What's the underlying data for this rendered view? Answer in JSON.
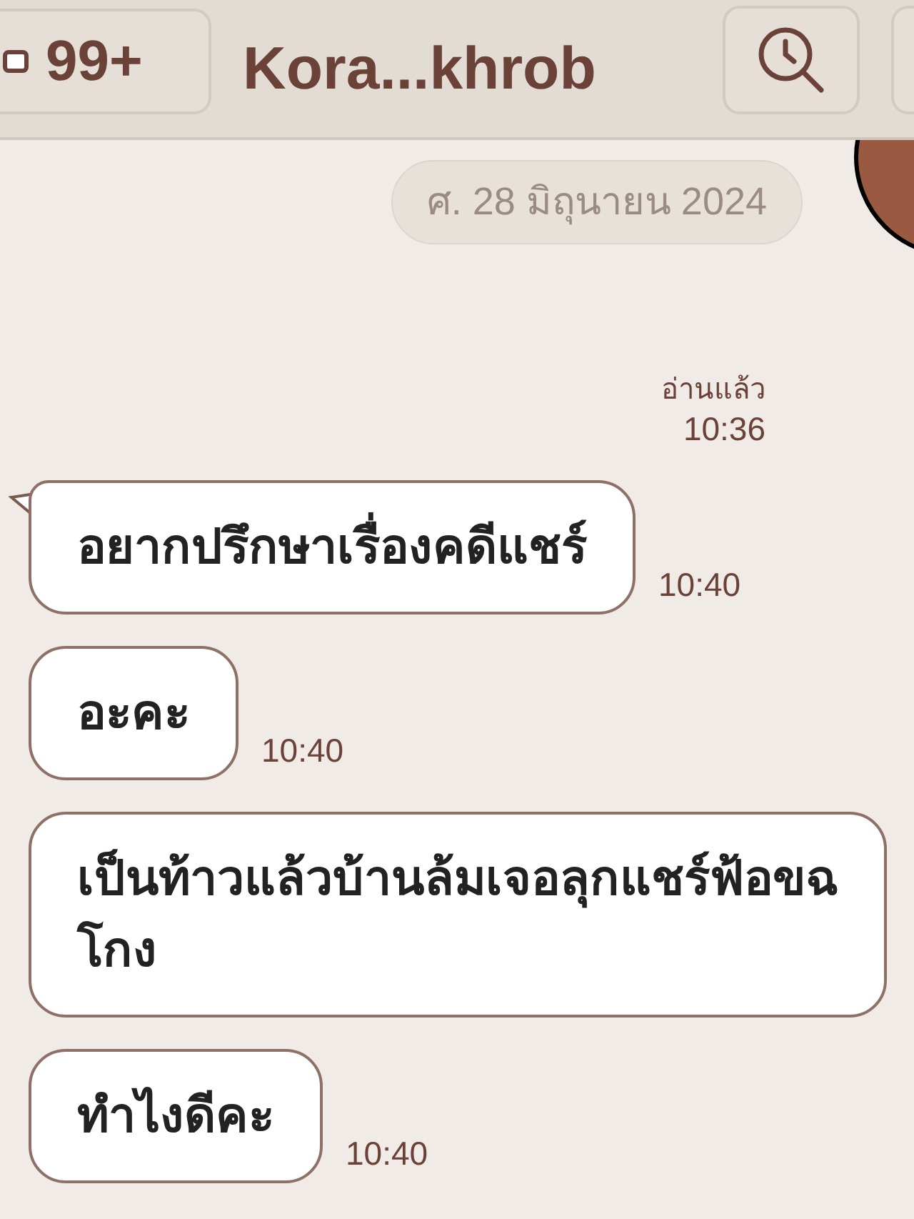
{
  "header": {
    "unread": "99+",
    "title": "Kora...khrob"
  },
  "date": "ศ. 28 มิถุนายน 2024",
  "read_receipt": {
    "status": "อ่านแล้ว",
    "time": "10:36"
  },
  "messages": [
    {
      "lines": [
        "อยากปรึกษาเรื่องคดีแชร์"
      ],
      "time": "10:40",
      "tail": true
    },
    {
      "lines": [
        "อะคะ"
      ],
      "time": "10:40",
      "tail": false
    },
    {
      "lines": [
        "เป็นท้าวแล้วบ้านล้มเจอลุกแชร์ฟ้อขฉ",
        "โกง"
      ],
      "tail": false
    },
    {
      "lines": [
        "ทำไงดีคะ"
      ],
      "time": "10:40",
      "tail": false
    }
  ]
}
